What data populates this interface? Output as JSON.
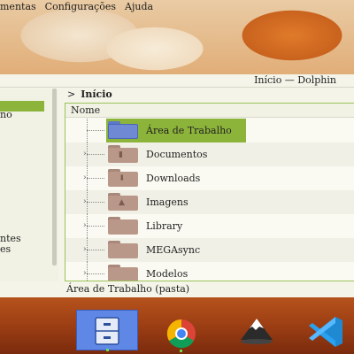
{
  "menubar": {
    "items": [
      "mentas",
      "Configurações",
      "Ajuda"
    ]
  },
  "window": {
    "title": "Início — Dolphin",
    "breadcrumb": {
      "separator": ">",
      "current": "Início"
    },
    "sidebar": {
      "items": [
        "no",
        "ntes",
        "es"
      ]
    },
    "column_header": "Nome",
    "files": [
      {
        "name": "Área de Trabalho",
        "icon": "desktop-folder-icon",
        "selected": true
      },
      {
        "name": "Documentos",
        "icon": "documents-folder-icon",
        "selected": false
      },
      {
        "name": "Downloads",
        "icon": "downloads-folder-icon",
        "selected": false
      },
      {
        "name": "Imagens",
        "icon": "pictures-folder-icon",
        "selected": false
      },
      {
        "name": "Library",
        "icon": "folder-icon",
        "selected": false
      },
      {
        "name": "MEGAsync",
        "icon": "folder-icon",
        "selected": false
      },
      {
        "name": "Modelos",
        "icon": "templates-folder-icon",
        "selected": false
      }
    ],
    "status": "Área de Trabalho (pasta)"
  },
  "panel": {
    "launchers": [
      {
        "name": "file-manager-launcher",
        "active": true
      },
      {
        "name": "chrome-launcher",
        "active": false
      },
      {
        "name": "inkscape-launcher",
        "active": false
      },
      {
        "name": "vscode-launcher",
        "active": false
      }
    ]
  },
  "colors": {
    "selection": "#8cb43a",
    "panel_active": "#5f87e6"
  }
}
